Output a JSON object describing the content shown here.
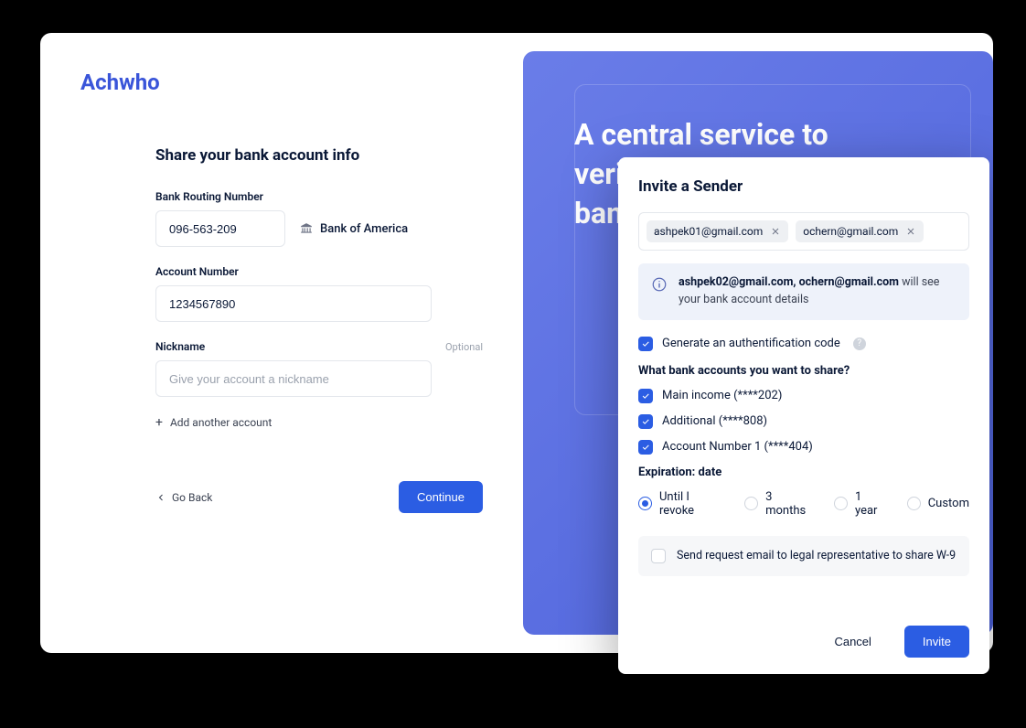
{
  "logo": "Achwho",
  "form": {
    "title": "Share your bank account info",
    "routing_label": "Bank Routing Number",
    "routing_value": "096-563-209",
    "bank_name": "Bank of America",
    "account_label": "Account Number",
    "account_value": "1234567890",
    "nickname_label": "Nickname",
    "nickname_optional": "Optional",
    "nickname_placeholder": "Give your account a nickname",
    "add_another": "Add another account",
    "go_back": "Go Back",
    "continue": "Continue"
  },
  "promo": {
    "title_line1": "A central service to",
    "title_line2": "verify your",
    "title_line3": "bank info"
  },
  "modal": {
    "title": "Invite a Sender",
    "chips": [
      {
        "label": "ashpek01@gmail.com"
      },
      {
        "label": "ochern@gmail.com"
      }
    ],
    "info_prefix": "ashpek02@gmail.com, ochern@gmail.com",
    "info_suffix": " will see your bank account details",
    "gen_code": "Generate an authentification code",
    "share_question": "What bank accounts you want to share?",
    "accounts": [
      "Main income (****202)",
      "Additional (****808)",
      "Account Number 1 (****404)"
    ],
    "expiration_label": "Expiration: date",
    "expiration_options": [
      "Until I revoke",
      "3 months",
      "1 year",
      "Custom"
    ],
    "legal": "Send request email to legal representative to share W-9",
    "cancel": "Cancel",
    "invite": "Invite"
  }
}
